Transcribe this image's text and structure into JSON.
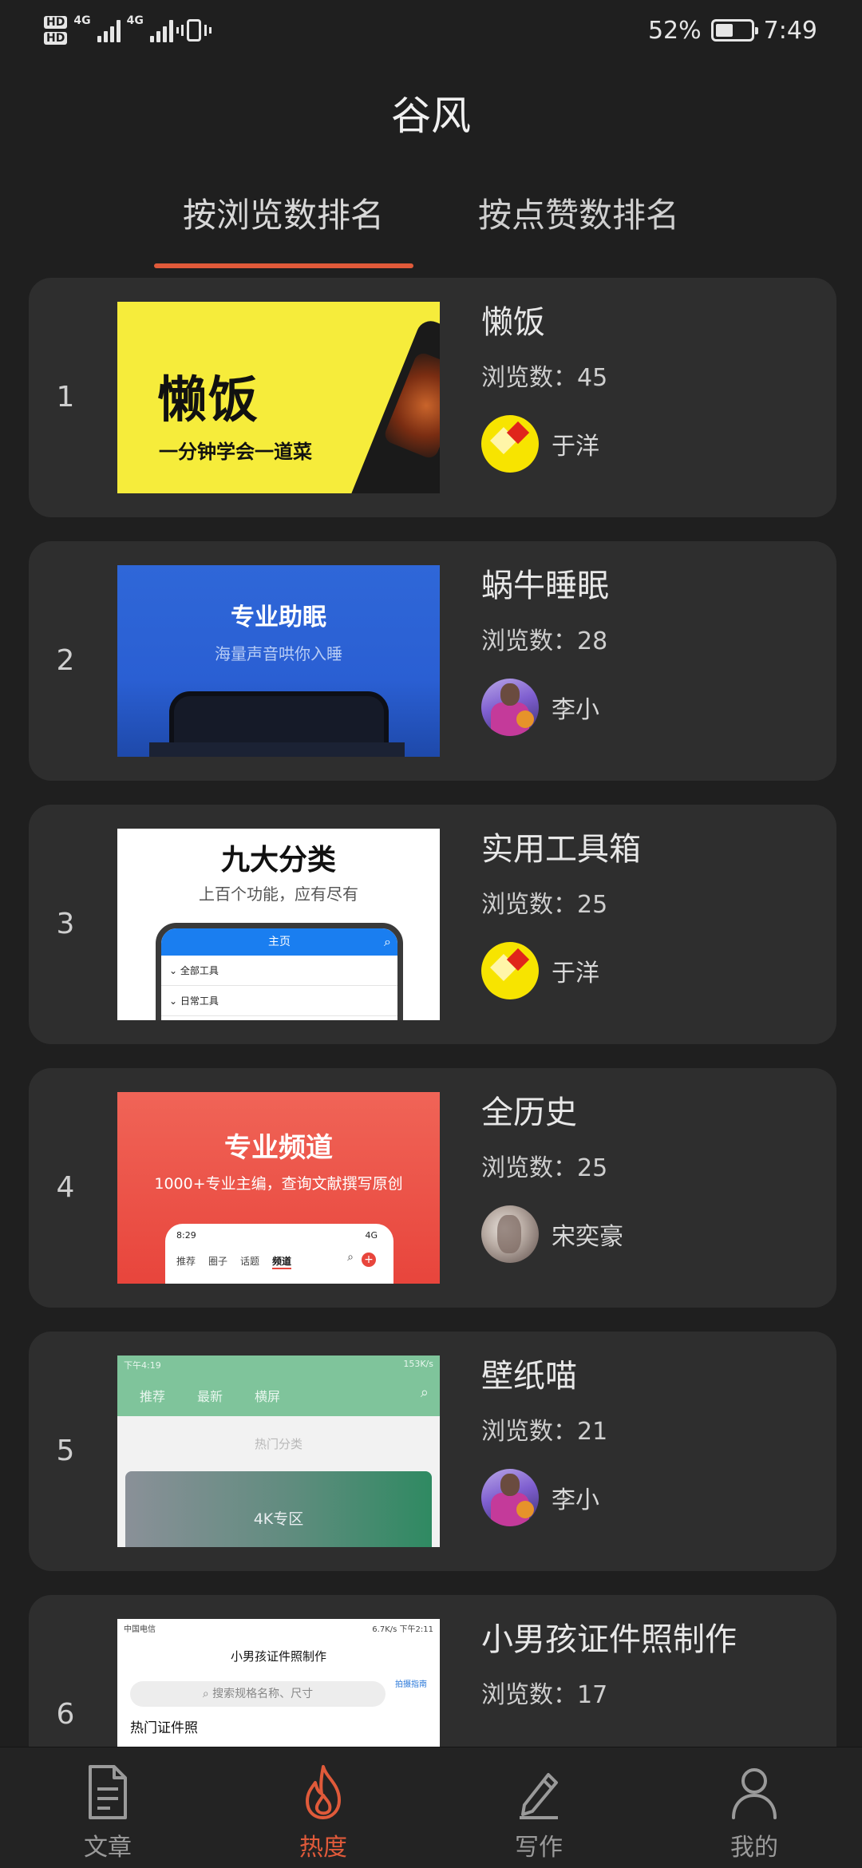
{
  "status_bar": {
    "hd1": "HD",
    "hd2": "HD",
    "net1": "4G",
    "net2": "4G",
    "battery": "52%",
    "battery_level": 0.52,
    "time": "7:49"
  },
  "header": {
    "title": "谷风"
  },
  "tabs": [
    {
      "label": "按浏览数排名",
      "active": true
    },
    {
      "label": "按点赞数排名",
      "active": false
    }
  ],
  "items": [
    {
      "rank": "1",
      "title": "懒饭",
      "views": "浏览数：45",
      "author": "于洋",
      "avatar": "yellow-logo",
      "thumb": {
        "big": "懒饭",
        "sub": "一分钟学会一道菜"
      }
    },
    {
      "rank": "2",
      "title": "蜗牛睡眠",
      "views": "浏览数：28",
      "author": "李小",
      "avatar": "basketball-player",
      "thumb": {
        "big": "专业助眠",
        "sub": "海量声音哄你入睡"
      }
    },
    {
      "rank": "3",
      "title": "实用工具箱",
      "views": "浏览数：25",
      "author": "于洋",
      "avatar": "yellow-logo",
      "thumb": {
        "big": "九大分类",
        "sub": "上百个功能，应有尽有",
        "bar": "主页",
        "row1": "全部工具",
        "row2": "日常工具"
      }
    },
    {
      "rank": "4",
      "title": "全历史",
      "views": "浏览数：25",
      "author": "宋奕豪",
      "avatar": "sketch-figure",
      "thumb": {
        "big": "专业频道",
        "sub": "1000+专业主编，查询文献撰写原创",
        "time": "8:29",
        "net": "4G",
        "t1": "推荐",
        "t2": "圈子",
        "t3": "话题",
        "t4": "频道"
      }
    },
    {
      "rank": "5",
      "title": "壁纸喵",
      "views": "浏览数：21",
      "author": "李小",
      "avatar": "basketball-player",
      "thumb": {
        "time": "下午4:19",
        "speed": "153K/s",
        "t1": "推荐",
        "t2": "最新",
        "t3": "横屏",
        "hot": "热门分类",
        "panel": "4K专区"
      }
    },
    {
      "rank": "6",
      "title": "小男孩证件照制作",
      "views": "浏览数：17",
      "thumb": {
        "carrier": "中国电信",
        "speed": "6.7K/s",
        "clock": "下午2:11",
        "head": "小男孩证件照制作",
        "search": "搜索规格名称、尺寸",
        "btn": "拍摄指南",
        "sec": "热门证件照"
      }
    }
  ],
  "bottom_nav": [
    {
      "label": "文章",
      "icon": "document-icon",
      "active": false
    },
    {
      "label": "热度",
      "icon": "flame-icon",
      "active": true
    },
    {
      "label": "写作",
      "icon": "pen-icon",
      "active": false
    },
    {
      "label": "我的",
      "icon": "person-icon",
      "active": false
    }
  ],
  "colors": {
    "accent": "#e05a3a",
    "background": "#1f1f1f",
    "card": "#2e2e2e"
  }
}
